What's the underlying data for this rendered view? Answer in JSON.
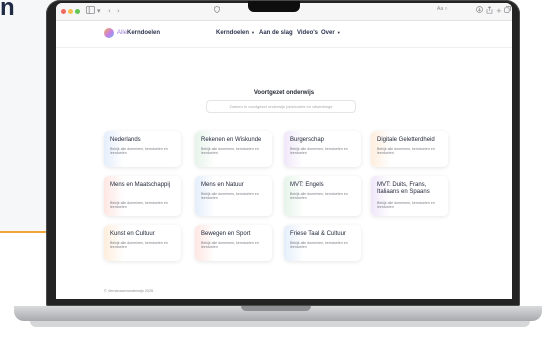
{
  "backdrop": {
    "partial_heading": "n"
  },
  "browser": {
    "url_icon": "shield-icon",
    "aa_label": "Aa ○"
  },
  "site": {
    "logo_prefix": "Alle",
    "logo_name": "Kerndoelen",
    "nav": [
      {
        "label": "Kerndoelen",
        "has_dropdown": true
      },
      {
        "label": "Aan de slag",
        "has_dropdown": false
      },
      {
        "label": "Video's",
        "has_dropdown": false
      },
      {
        "label": "Over",
        "has_dropdown": true
      }
    ]
  },
  "main": {
    "heading": "Voortgezet onderwijs",
    "search": {
      "placeholder": "Zoeken in voortgezet onderwijs (doelcodes en uitwerkinge",
      "value": ""
    },
    "cards": [
      {
        "title": "Nederlands",
        "desc": "Bekijk alle domeinen, kerndoelen en leerdoelen",
        "tint": "#e4eefb"
      },
      {
        "title": "Rekenen en Wiskunde",
        "desc": "Bekijk alle domeinen, kerndoelen en leerdoelen",
        "tint": "#e6f4ea"
      },
      {
        "title": "Burgerschap",
        "desc": "Bekijk alle domeinen, kerndoelen en leerdoelen",
        "tint": "#f0e7fa"
      },
      {
        "title": "Digitale Geletterdheid",
        "desc": "Bekijk alle domeinen, kerndoelen en leerdoelen",
        "tint": "#fdeedd"
      },
      {
        "title": "Mens en Maatschappij",
        "desc": "Bekijk alle domeinen, kerndoelen en leerdoelen",
        "tint": "#fde6e2"
      },
      {
        "title": "Mens en Natuur",
        "desc": "Bekijk alle domeinen, kerndoelen en leerdoelen",
        "tint": "#e4eefb"
      },
      {
        "title": "MVT: Engels",
        "desc": "Bekijk alle domeinen, kerndoelen en leerdoelen",
        "tint": "#e6f4ea"
      },
      {
        "title": "MVT: Duits, Frans, Italiaans en Spaans",
        "desc": "Bekijk alle domeinen, kerndoelen en leerdoelen",
        "tint": "#f0e7fa"
      },
      {
        "title": "Kunst en Cultuur",
        "desc": "Bekijk alle domeinen, kerndoelen en leerdoelen",
        "tint": "#fdeedd"
      },
      {
        "title": "Bewegen en Sport",
        "desc": "Bekijk alle domeinen, kerndoelen en leerdoelen",
        "tint": "#fde6e2"
      },
      {
        "title": "Friese Taal & Cultuur",
        "desc": "Bekijk alle domeinen, kerndoelen en leerdoelen",
        "tint": "#e4eefb"
      }
    ]
  },
  "footer": {
    "text": "© Vernieuwenonderwijs 2026"
  },
  "colors": {
    "traffic_red": "#ee6a5f",
    "traffic_yellow": "#f5be4f",
    "traffic_green": "#62c554",
    "accent_orange": "#f2a63a"
  }
}
